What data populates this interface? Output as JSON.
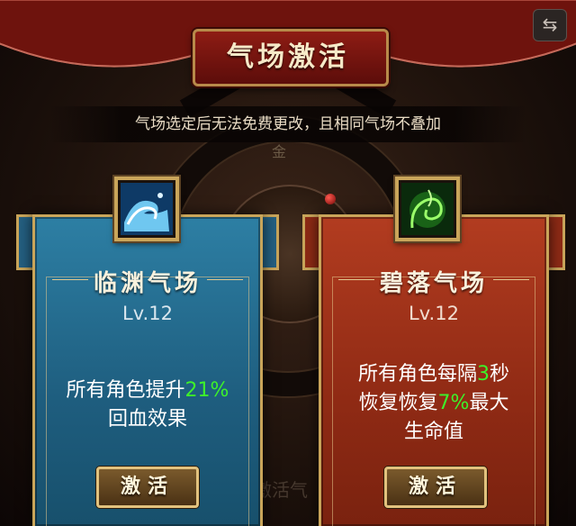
{
  "header": {
    "title": "气场激活",
    "switch_icon": "swap-arrows-icon",
    "switch_glyph": "⇆"
  },
  "notice": "气场选定后无法免费更改，且相同气场不叠加",
  "background": {
    "gold_tag": "金",
    "faded_label": "激活气"
  },
  "cards": [
    {
      "name": "临渊气场",
      "level": "Lv.12",
      "desc_prefix": "所有角色提升",
      "desc_value": "21%",
      "desc_line2": "回血效果",
      "button": "激活",
      "icon": "water-wave-icon",
      "theme_color": "#2d7fa4"
    },
    {
      "name": "碧落气场",
      "level": "Lv.12",
      "desc_prefix": "所有角色每隔",
      "desc_value": "3",
      "desc_unit": "秒",
      "desc_line2_prefix": "恢复恢复",
      "desc_line2_value": "7%",
      "desc_line2_suffix": "最大",
      "desc_line3": "生命值",
      "button": "激活",
      "icon": "green-vine-icon",
      "theme_color": "#b23c20"
    }
  ],
  "colors": {
    "highlight": "#3df22a",
    "gold_border": "#c9a55a",
    "title_red": "#8e1c14"
  }
}
